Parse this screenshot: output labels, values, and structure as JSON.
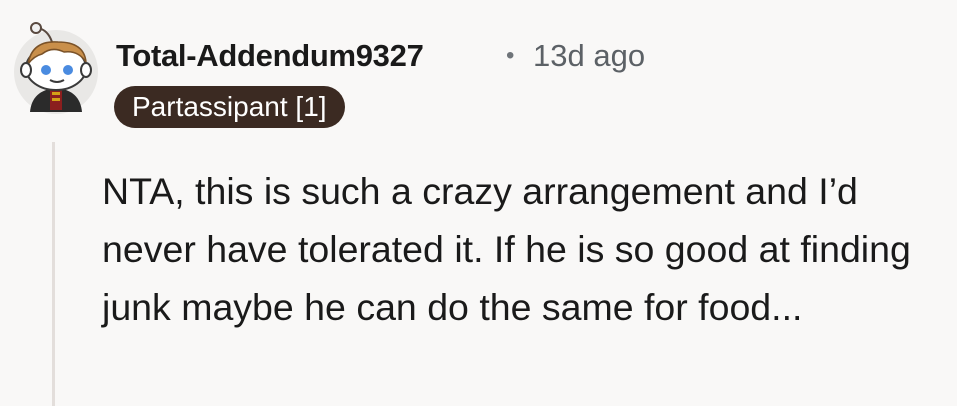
{
  "comment": {
    "username": "Total-Addendum9327",
    "separator": "•",
    "timestamp": "13d ago",
    "flair": "Partassipant [1]",
    "body": "NTA, this is such a crazy arrangement and I’d never have tolerated it. If he is so good at finding junk maybe he can do the same for food...",
    "avatar": "reddit-snoo-avatar-icon"
  },
  "colors": {
    "background": "#f9f8f7",
    "flair_bg": "#3b2a22",
    "flair_text": "#ffffff",
    "meta_text": "#5c6166",
    "thread_line": "#e3dedb"
  }
}
